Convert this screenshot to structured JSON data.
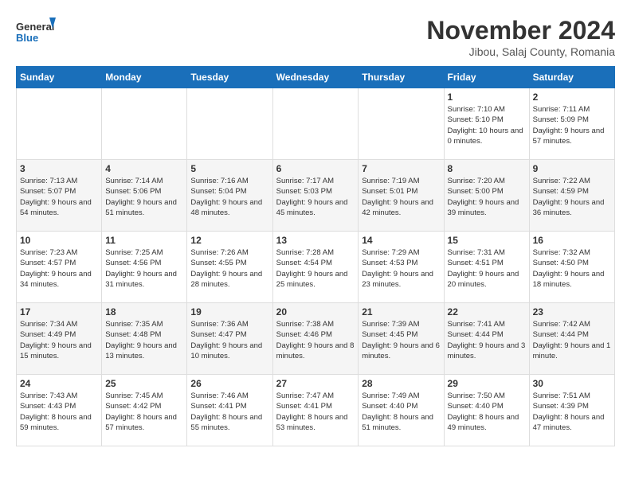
{
  "logo": {
    "line1": "General",
    "line2": "Blue"
  },
  "title": "November 2024",
  "subtitle": "Jibou, Salaj County, Romania",
  "weekdays": [
    "Sunday",
    "Monday",
    "Tuesday",
    "Wednesday",
    "Thursday",
    "Friday",
    "Saturday"
  ],
  "weeks": [
    [
      {
        "day": "",
        "info": ""
      },
      {
        "day": "",
        "info": ""
      },
      {
        "day": "",
        "info": ""
      },
      {
        "day": "",
        "info": ""
      },
      {
        "day": "",
        "info": ""
      },
      {
        "day": "1",
        "info": "Sunrise: 7:10 AM\nSunset: 5:10 PM\nDaylight: 10 hours and 0 minutes."
      },
      {
        "day": "2",
        "info": "Sunrise: 7:11 AM\nSunset: 5:09 PM\nDaylight: 9 hours and 57 minutes."
      }
    ],
    [
      {
        "day": "3",
        "info": "Sunrise: 7:13 AM\nSunset: 5:07 PM\nDaylight: 9 hours and 54 minutes."
      },
      {
        "day": "4",
        "info": "Sunrise: 7:14 AM\nSunset: 5:06 PM\nDaylight: 9 hours and 51 minutes."
      },
      {
        "day": "5",
        "info": "Sunrise: 7:16 AM\nSunset: 5:04 PM\nDaylight: 9 hours and 48 minutes."
      },
      {
        "day": "6",
        "info": "Sunrise: 7:17 AM\nSunset: 5:03 PM\nDaylight: 9 hours and 45 minutes."
      },
      {
        "day": "7",
        "info": "Sunrise: 7:19 AM\nSunset: 5:01 PM\nDaylight: 9 hours and 42 minutes."
      },
      {
        "day": "8",
        "info": "Sunrise: 7:20 AM\nSunset: 5:00 PM\nDaylight: 9 hours and 39 minutes."
      },
      {
        "day": "9",
        "info": "Sunrise: 7:22 AM\nSunset: 4:59 PM\nDaylight: 9 hours and 36 minutes."
      }
    ],
    [
      {
        "day": "10",
        "info": "Sunrise: 7:23 AM\nSunset: 4:57 PM\nDaylight: 9 hours and 34 minutes."
      },
      {
        "day": "11",
        "info": "Sunrise: 7:25 AM\nSunset: 4:56 PM\nDaylight: 9 hours and 31 minutes."
      },
      {
        "day": "12",
        "info": "Sunrise: 7:26 AM\nSunset: 4:55 PM\nDaylight: 9 hours and 28 minutes."
      },
      {
        "day": "13",
        "info": "Sunrise: 7:28 AM\nSunset: 4:54 PM\nDaylight: 9 hours and 25 minutes."
      },
      {
        "day": "14",
        "info": "Sunrise: 7:29 AM\nSunset: 4:53 PM\nDaylight: 9 hours and 23 minutes."
      },
      {
        "day": "15",
        "info": "Sunrise: 7:31 AM\nSunset: 4:51 PM\nDaylight: 9 hours and 20 minutes."
      },
      {
        "day": "16",
        "info": "Sunrise: 7:32 AM\nSunset: 4:50 PM\nDaylight: 9 hours and 18 minutes."
      }
    ],
    [
      {
        "day": "17",
        "info": "Sunrise: 7:34 AM\nSunset: 4:49 PM\nDaylight: 9 hours and 15 minutes."
      },
      {
        "day": "18",
        "info": "Sunrise: 7:35 AM\nSunset: 4:48 PM\nDaylight: 9 hours and 13 minutes."
      },
      {
        "day": "19",
        "info": "Sunrise: 7:36 AM\nSunset: 4:47 PM\nDaylight: 9 hours and 10 minutes."
      },
      {
        "day": "20",
        "info": "Sunrise: 7:38 AM\nSunset: 4:46 PM\nDaylight: 9 hours and 8 minutes."
      },
      {
        "day": "21",
        "info": "Sunrise: 7:39 AM\nSunset: 4:45 PM\nDaylight: 9 hours and 6 minutes."
      },
      {
        "day": "22",
        "info": "Sunrise: 7:41 AM\nSunset: 4:44 PM\nDaylight: 9 hours and 3 minutes."
      },
      {
        "day": "23",
        "info": "Sunrise: 7:42 AM\nSunset: 4:44 PM\nDaylight: 9 hours and 1 minute."
      }
    ],
    [
      {
        "day": "24",
        "info": "Sunrise: 7:43 AM\nSunset: 4:43 PM\nDaylight: 8 hours and 59 minutes."
      },
      {
        "day": "25",
        "info": "Sunrise: 7:45 AM\nSunset: 4:42 PM\nDaylight: 8 hours and 57 minutes."
      },
      {
        "day": "26",
        "info": "Sunrise: 7:46 AM\nSunset: 4:41 PM\nDaylight: 8 hours and 55 minutes."
      },
      {
        "day": "27",
        "info": "Sunrise: 7:47 AM\nSunset: 4:41 PM\nDaylight: 8 hours and 53 minutes."
      },
      {
        "day": "28",
        "info": "Sunrise: 7:49 AM\nSunset: 4:40 PM\nDaylight: 8 hours and 51 minutes."
      },
      {
        "day": "29",
        "info": "Sunrise: 7:50 AM\nSunset: 4:40 PM\nDaylight: 8 hours and 49 minutes."
      },
      {
        "day": "30",
        "info": "Sunrise: 7:51 AM\nSunset: 4:39 PM\nDaylight: 8 hours and 47 minutes."
      }
    ]
  ]
}
